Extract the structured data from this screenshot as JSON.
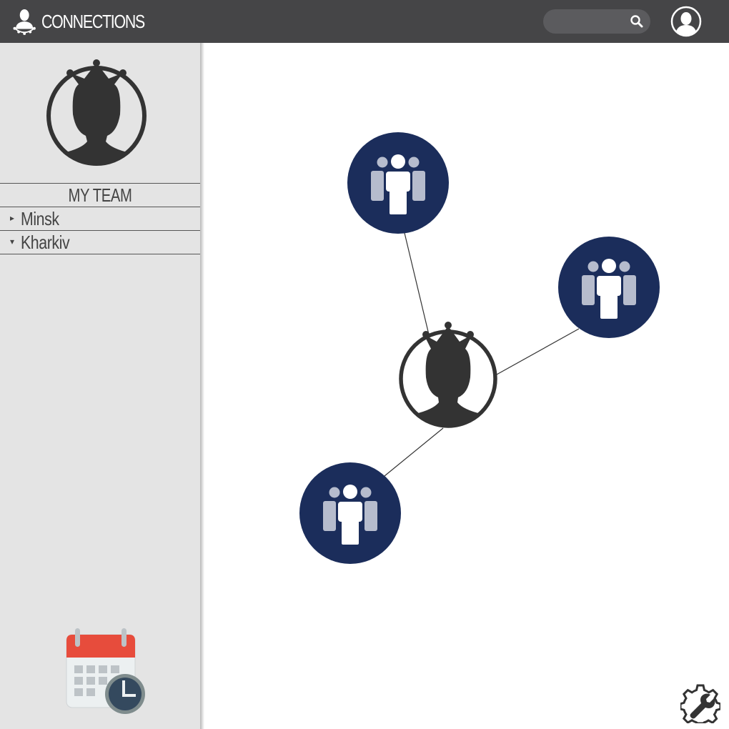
{
  "header": {
    "app_title": "CONNECTIONS",
    "search": {
      "placeholder": ""
    }
  },
  "sidebar": {
    "section_title": "MY TEAM",
    "items": [
      {
        "label": "Minsk",
        "arrow": "▸",
        "state": "collapsed"
      },
      {
        "label": "Kharkiv",
        "arrow": "▾",
        "state": "expanded"
      }
    ]
  },
  "icons": {
    "brand": "leader-icon",
    "search": "search-icon",
    "account": "user-account-icon",
    "calendar": "calendar-clock-icon",
    "settings": "gear-wrench-icon",
    "team": "team-group-icon",
    "leader": "crowned-person-icon"
  },
  "colors": {
    "header_bg": "#454547",
    "sidebar_bg": "#e4e4e4",
    "node_fill": "#1b2d5b",
    "leader": "#333333",
    "calendar_red": "#e74c3c",
    "clock": "#34495e"
  }
}
